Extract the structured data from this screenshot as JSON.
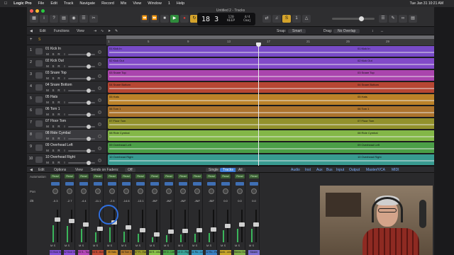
{
  "menubar": {
    "apple_icon": "apple-logo-icon",
    "items": [
      "Logic Pro",
      "File",
      "Edit",
      "Track",
      "Navigate",
      "Record",
      "Mix",
      "View",
      "Window",
      "1",
      "Help"
    ],
    "clock": "Tue Jan 31  10:21 AM"
  },
  "window": {
    "title": "Untitled 2 - Tracks"
  },
  "lcd": {
    "position": "18  3",
    "tempo": "120",
    "tempo_label": "KEEP",
    "signature": "4/4",
    "key": "Cmaj"
  },
  "toolbar": {
    "edit": "Edit",
    "functions": "Functions",
    "view": "View",
    "snap_label": "Snap:",
    "snap_value": "Smart",
    "drag_label": "Drag:",
    "drag_value": "No Overlap"
  },
  "ruler": {
    "bars": [
      "1",
      "5",
      "9",
      "13",
      "17",
      "21",
      "25",
      "29"
    ]
  },
  "tracks": [
    {
      "num": "1",
      "name": "01 Kick In",
      "color": "#7f4fd4",
      "region": "01 Kick In"
    },
    {
      "num": "2",
      "name": "02 Kick Out",
      "color": "#8a4ed6",
      "region": "02 Kick Out"
    },
    {
      "num": "3",
      "name": "03 Snare Top",
      "color": "#b547b8",
      "region": "03 Snare Top"
    },
    {
      "num": "4",
      "name": "04 Snare Bottom",
      "color": "#c24a35",
      "region": "04 Snare Bottom"
    },
    {
      "num": "5",
      "name": "05 Hats",
      "color": "#c78a2a",
      "region": "05 Hats"
    },
    {
      "num": "6",
      "name": "06 Tom 1",
      "color": "#b77a2e",
      "region": "06 Tom 1"
    },
    {
      "num": "7",
      "name": "07 Floor Tom",
      "color": "#9b9a2d",
      "region": "07 Floor Tom"
    },
    {
      "num": "8",
      "name": "08 Ride Cymbal",
      "color": "#8bc34a",
      "region": "08 Ride Cymbal"
    },
    {
      "num": "9",
      "name": "09 Overhead Left",
      "color": "#4fa84a",
      "region": "09 Overhead Left"
    },
    {
      "num": "10",
      "name": "10 Overhead Right",
      "color": "#3aa59a",
      "region": "10 Overhead Right"
    }
  ],
  "track_buttons": {
    "m": "M",
    "s": "S",
    "r": "R",
    "i": "I"
  },
  "mixer_bar": {
    "edit": "Edit",
    "options": "Options",
    "view": "View",
    "sends_on_faders": "Sends on Faders:",
    "sends_value": "Off",
    "tab_single": "Single",
    "tab_tracks": "Tracks",
    "tab_all": "All",
    "filters": [
      "Audio",
      "Inst",
      "Aux",
      "Bus",
      "Input",
      "Output",
      "Master/VCA",
      "MIDI"
    ]
  },
  "mixer_labels": {
    "automation": "Automation",
    "pan": "Pan",
    "db": "dB"
  },
  "strips": [
    {
      "label": "01 Kick In",
      "color": "#7f4fd4",
      "db": "-0.3",
      "level": 0.72,
      "read": "Read"
    },
    {
      "label": "02 Kick Out",
      "color": "#8a4ed6",
      "db": "-2.7",
      "level": 0.68,
      "read": "Read"
    },
    {
      "label": "03 S...Top",
      "color": "#b547b8",
      "db": "-4.4",
      "level": 0.55,
      "read": "Read"
    },
    {
      "label": "04 S...ttom",
      "color": "#c24a35",
      "db": "-11.1",
      "level": 0.4,
      "read": "Read"
    },
    {
      "label": "05 Hats",
      "color": "#c78a2a",
      "db": "-2.5",
      "level": 0.62,
      "read": "Read"
    },
    {
      "label": "06 Tom 1",
      "color": "#b77a2e",
      "db": "-14.6",
      "level": 0.45,
      "read": "Read"
    },
    {
      "label": "07 Fl...Tom",
      "color": "#9b9a2d",
      "db": "-13.1",
      "level": 0.35,
      "read": "Read"
    },
    {
      "label": "08 R...mbal",
      "color": "#8bc34a",
      "db": "-INF",
      "level": 0.2,
      "read": "Read"
    },
    {
      "label": "09 O...Left",
      "color": "#4fa84a",
      "db": "-INF",
      "level": 0.3,
      "read": "Read"
    },
    {
      "label": "10 O...Right",
      "color": "#3aa59a",
      "db": "-INF",
      "level": 0.32,
      "read": "Read"
    },
    {
      "label": "11 Ro...Left",
      "color": "#3a98c2",
      "db": "-INF",
      "level": 0.36,
      "read": "Read"
    },
    {
      "label": "12 Ro...Right",
      "color": "#3a7fc2",
      "db": "-INF",
      "level": 0.38,
      "read": "Read"
    },
    {
      "label": "Amb...ome",
      "color": "#c7a52a",
      "db": "0.0",
      "level": 0.5,
      "read": "Read"
    },
    {
      "label": "Stereo Out",
      "color": "#7fae4a",
      "db": "0.0",
      "level": 0.55,
      "read": "Read"
    },
    {
      "label": "Master",
      "color": "#7b6ecf",
      "db": "0.0",
      "level": 0.55,
      "read": "Read"
    }
  ],
  "colors": {
    "accent": "#3d7bd4",
    "highlight_ring": "#2f6fe0"
  }
}
